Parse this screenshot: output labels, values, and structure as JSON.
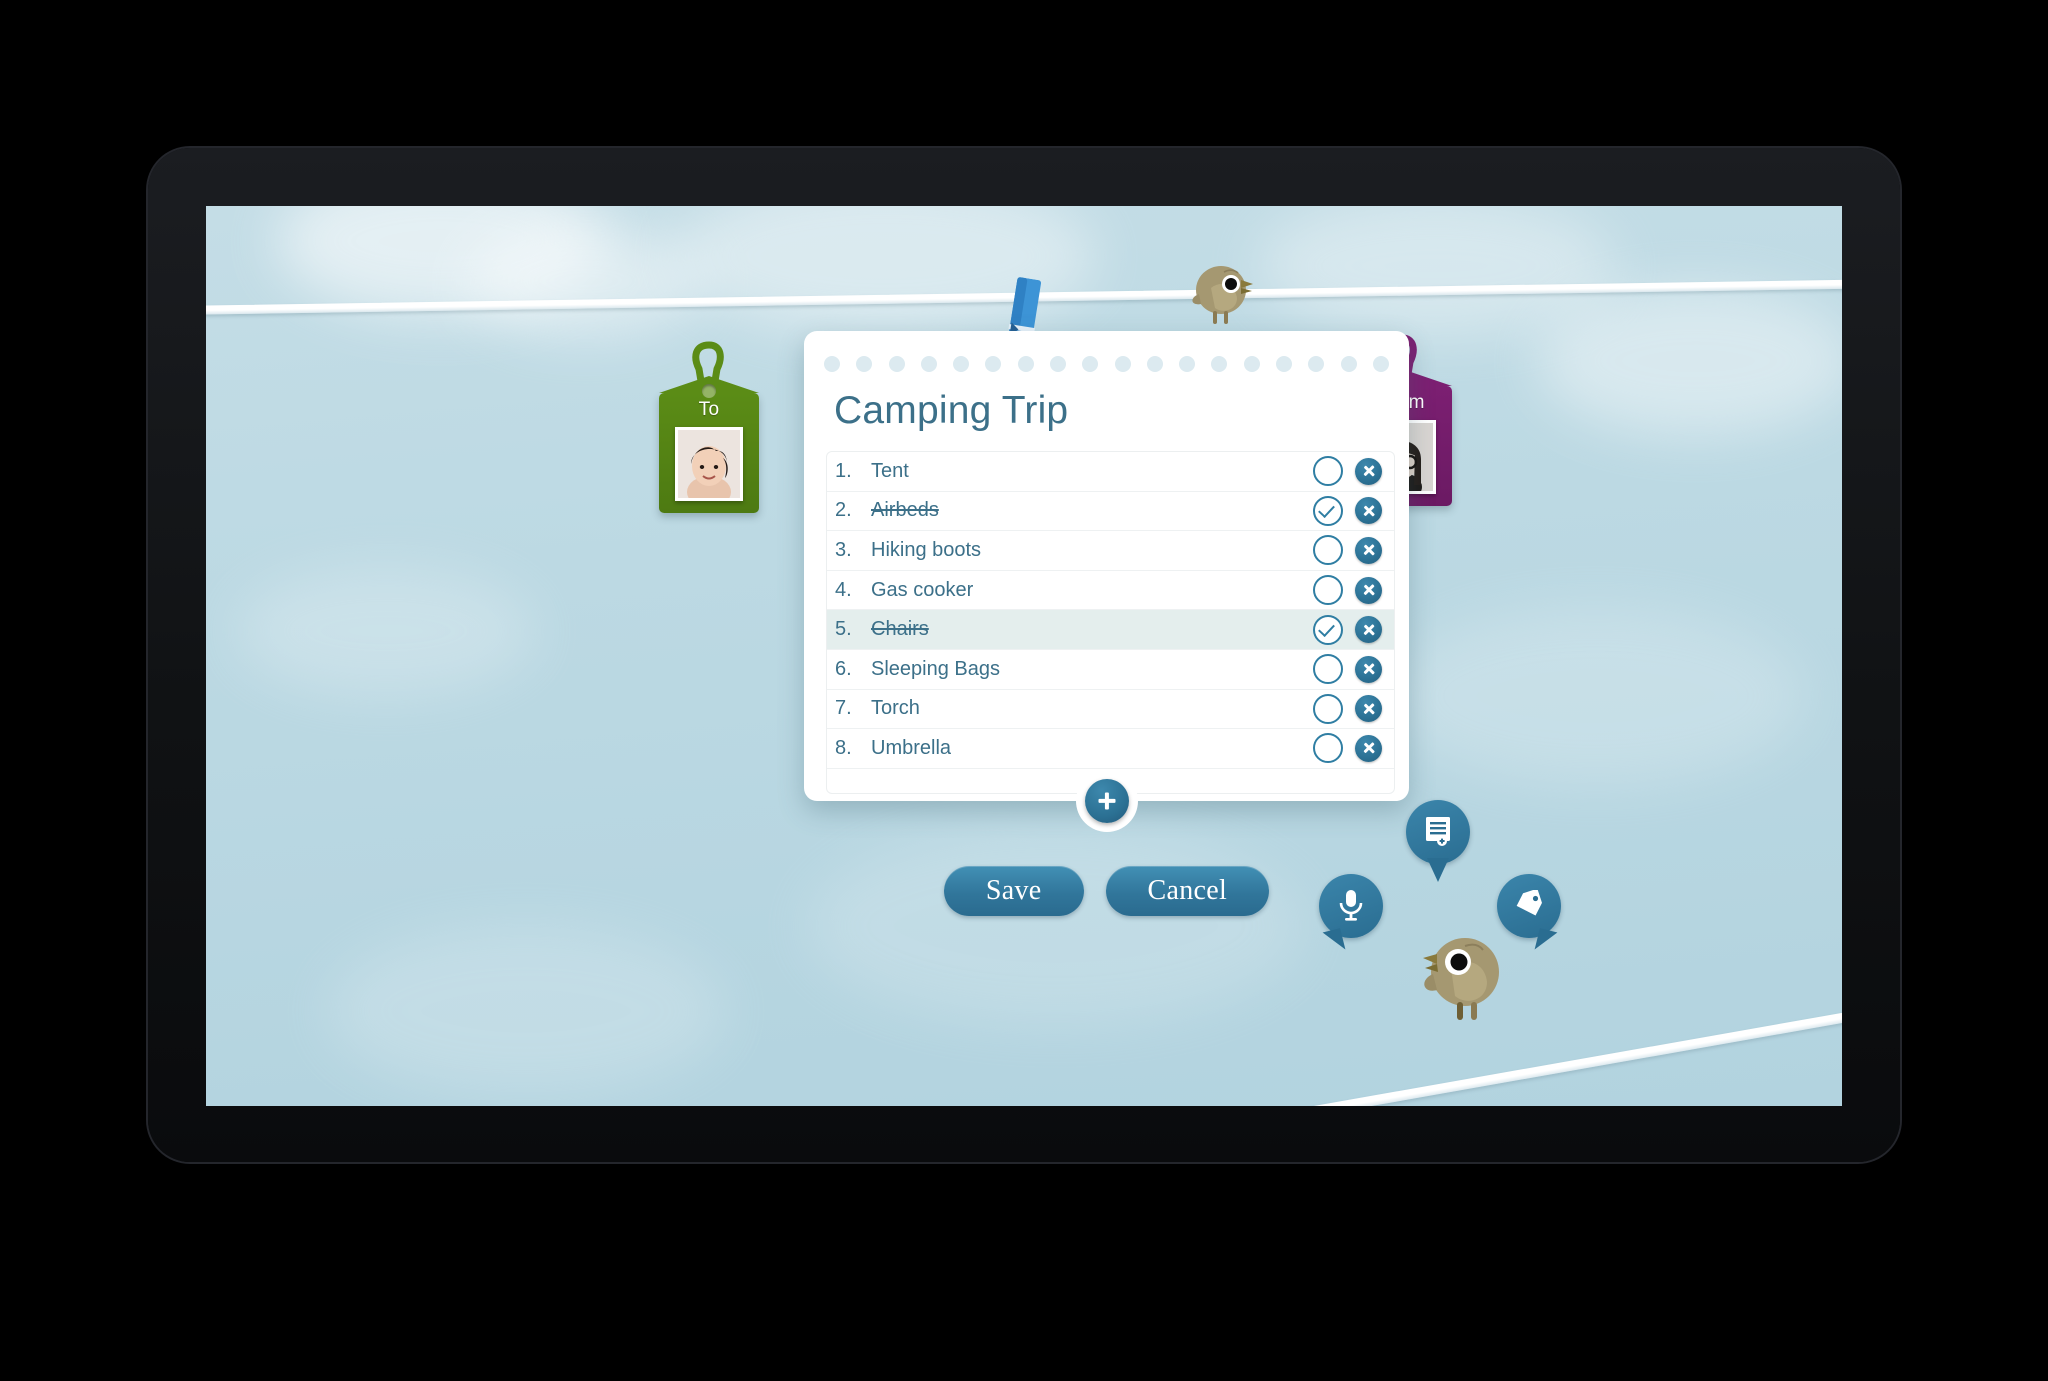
{
  "app": {
    "background_color": "#bfdbe4",
    "accent_color": "#2f7ea3",
    "title_color": "#3c7089"
  },
  "note": {
    "title": "Camping Trip",
    "dot_count": 18,
    "items": [
      {
        "number": "1.",
        "label": "Tent",
        "checked": false,
        "highlighted": false
      },
      {
        "number": "2.",
        "label": "Airbeds",
        "checked": true,
        "highlighted": false
      },
      {
        "number": "3.",
        "label": "Hiking boots",
        "checked": false,
        "highlighted": false
      },
      {
        "number": "4.",
        "label": "Gas cooker",
        "checked": false,
        "highlighted": false
      },
      {
        "number": "5.",
        "label": "Chairs",
        "checked": true,
        "highlighted": true
      },
      {
        "number": "6.",
        "label": "Sleeping Bags",
        "checked": false,
        "highlighted": false
      },
      {
        "number": "7.",
        "label": "Torch",
        "checked": false,
        "highlighted": false
      },
      {
        "number": "8.",
        "label": "Umbrella",
        "checked": false,
        "highlighted": false
      }
    ],
    "add_item_icon": "plus-icon"
  },
  "actions": {
    "save_label": "Save",
    "cancel_label": "Cancel"
  },
  "tags": {
    "to": {
      "label": "To",
      "color": "#5b8c16",
      "photo": "avatar-short-dark-hair"
    },
    "from": {
      "label": "From",
      "color": "#7c1f72",
      "photo": "avatar-glasses-bangs"
    }
  },
  "tools": [
    {
      "name": "microphone-icon",
      "color": "#2a6d91"
    },
    {
      "name": "add-note-icon",
      "color": "#2a6d91"
    },
    {
      "name": "label-tag-icon",
      "color": "#2a6d91"
    }
  ],
  "decor": {
    "clothespin": "clothespin-icon",
    "bird_top": "bird-icon",
    "bird_bottom": "bird-icon",
    "clothesline": "clothesline"
  }
}
